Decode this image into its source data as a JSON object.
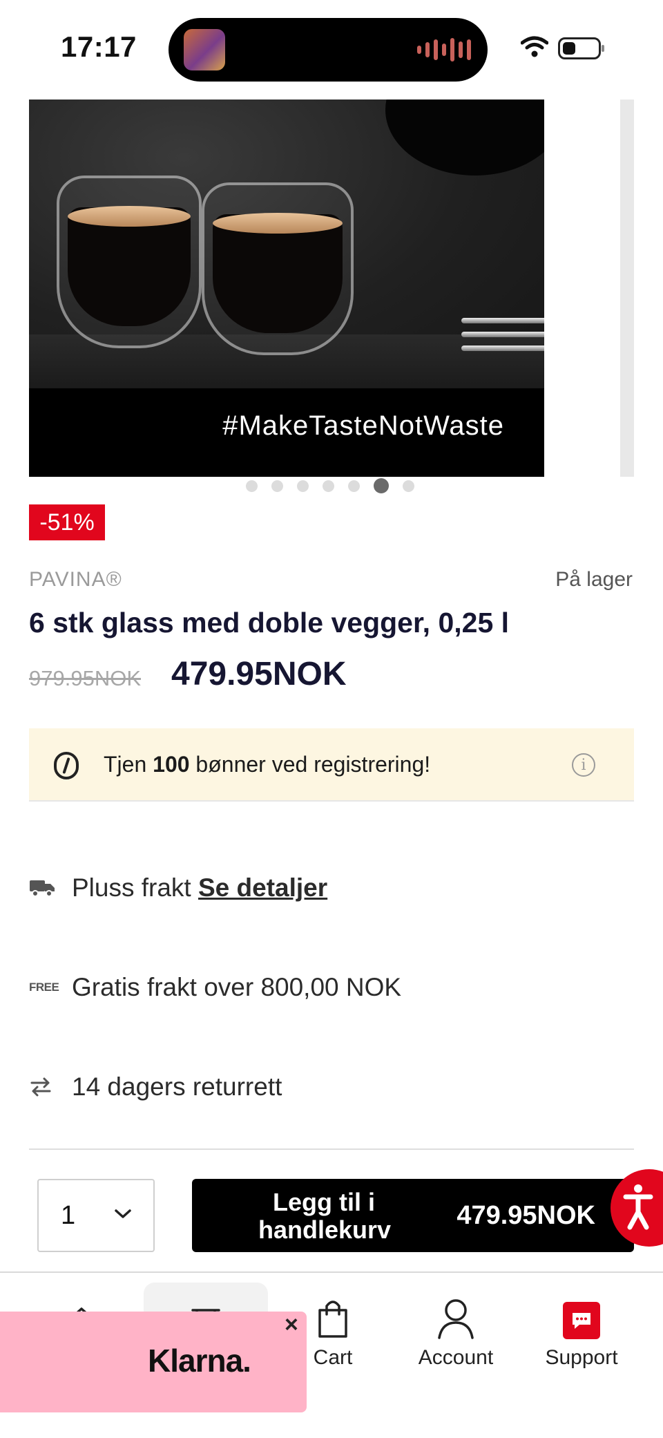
{
  "status_bar": {
    "time": "17:17"
  },
  "carousel": {
    "caption": "#MakeTasteNotWaste",
    "slide_count": 7,
    "active_slide": 6
  },
  "product": {
    "discount": "-51%",
    "brand": "PAVINA®",
    "stock": "På lager",
    "title": "6 stk glass med doble vegger, 0,25 l",
    "price_old": "979.95NOK",
    "price_new": "479.95NOK"
  },
  "points": {
    "prefix": "Tjen ",
    "amount": "100",
    "suffix": " bønner ved registrering!"
  },
  "perks": {
    "shipping_text": "Pluss frakt ",
    "shipping_link": "Se detaljer",
    "free_badge": "FREE",
    "free_shipping": "Gratis frakt over  800,00 NOK",
    "returns": "14 dagers returrett"
  },
  "cart": {
    "quantity": "1",
    "add_label": "Legg til i handlekurv",
    "price": "479.95NOK"
  },
  "nav": {
    "cart": "Cart",
    "account": "Account",
    "support": "Support"
  },
  "klarna": {
    "logo": "Klarna.",
    "close": "×"
  },
  "colors": {
    "accent": "#e1061d",
    "banner": "#fdf6e1",
    "klarna": "#ffb3c7",
    "text_dark": "#161632"
  }
}
